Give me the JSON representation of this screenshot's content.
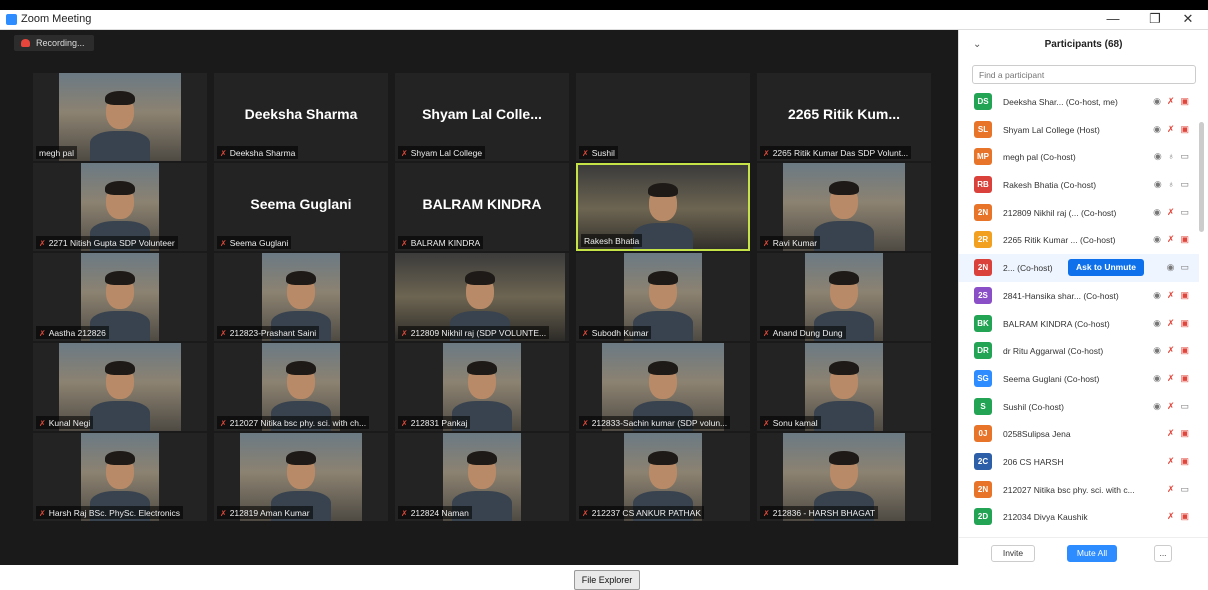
{
  "window": {
    "title": "Zoom Meeting",
    "minimize": "—",
    "restore": "❐",
    "close": "✕"
  },
  "recording": {
    "label": "Recording..."
  },
  "tiles": [
    {
      "name": "megh pal",
      "bigname": "",
      "video": "person",
      "mic_muted": false
    },
    {
      "name": "Deeksha Sharma",
      "bigname": "Deeksha Sharma",
      "video": "off",
      "mic_muted": true
    },
    {
      "name": "Shyam Lal College",
      "bigname": "Shyam Lal Colle...",
      "video": "off",
      "mic_muted": true
    },
    {
      "name": "Sushil",
      "bigname": "",
      "video": "off",
      "mic_muted": true
    },
    {
      "name": "2265 Ritik Kumar Das SDP Volunt...",
      "bigname": "2265 Ritik Kum...",
      "video": "off",
      "mic_muted": true
    },
    {
      "name": "2271 Nitish Gupta SDP Volunteer",
      "bigname": "",
      "video": "person",
      "mic_muted": true
    },
    {
      "name": "Seema Guglani",
      "bigname": "Seema Guglani",
      "video": "off",
      "mic_muted": true
    },
    {
      "name": "BALRAM KINDRA",
      "bigname": "BALRAM KINDRA",
      "video": "off",
      "mic_muted": true
    },
    {
      "name": "Rakesh Bhatia",
      "bigname": "",
      "video": "wide",
      "mic_muted": false,
      "active": true
    },
    {
      "name": "Ravi Kumar",
      "bigname": "",
      "video": "person",
      "mic_muted": true
    },
    {
      "name": "Aastha 212826",
      "bigname": "",
      "video": "person",
      "mic_muted": true
    },
    {
      "name": "212823-Prashant Saini",
      "bigname": "",
      "video": "person",
      "mic_muted": true
    },
    {
      "name": "212809 Nikhil raj (SDP VOLUNTE...",
      "bigname": "",
      "video": "wide",
      "mic_muted": true
    },
    {
      "name": "Subodh Kumar",
      "bigname": "",
      "video": "person",
      "mic_muted": true
    },
    {
      "name": "Anand Dung Dung",
      "bigname": "",
      "video": "person",
      "mic_muted": true
    },
    {
      "name": "Kunal Negi",
      "bigname": "",
      "video": "person",
      "mic_muted": true
    },
    {
      "name": "212027 Nitika bsc phy. sci. with ch...",
      "bigname": "",
      "video": "person",
      "mic_muted": true
    },
    {
      "name": "212831 Pankaj",
      "bigname": "",
      "video": "person",
      "mic_muted": true
    },
    {
      "name": "212833-Sachin kumar (SDP volun...",
      "bigname": "",
      "video": "person",
      "mic_muted": true
    },
    {
      "name": "Sonu kamal",
      "bigname": "",
      "video": "person",
      "mic_muted": true
    },
    {
      "name": "Harsh Raj BSc. PhySc. Electronics",
      "bigname": "",
      "video": "person",
      "mic_muted": true
    },
    {
      "name": "212819 Aman Kumar",
      "bigname": "",
      "video": "person",
      "mic_muted": true
    },
    {
      "name": "212824 Naman",
      "bigname": "",
      "video": "person",
      "mic_muted": true
    },
    {
      "name": "212237 CS ANKUR PATHAK",
      "bigname": "",
      "video": "person",
      "mic_muted": true
    },
    {
      "name": "212836 - HARSH BHAGAT",
      "bigname": "",
      "video": "person",
      "mic_muted": true
    }
  ],
  "file_explorer": {
    "label": "File Explorer"
  },
  "participants": {
    "title": "Participants (68)",
    "collapse": "⌄",
    "search_placeholder": "Find a participant",
    "list": [
      {
        "initials": "DS",
        "color": "#23a455",
        "name": "Deeksha Shar...  (Co-host, me)",
        "mic": "muted",
        "video": "off"
      },
      {
        "initials": "SL",
        "color": "#e8742a",
        "name": "Shyam Lal College (Host)",
        "mic": "muted",
        "video": "off"
      },
      {
        "initials": "MP",
        "color": "#e8742a",
        "name": "megh pal (Co-host)",
        "mic": "on",
        "video": "on"
      },
      {
        "initials": "RB",
        "color": "#d9413a",
        "name": "Rakesh Bhatia (Co-host)",
        "mic": "on",
        "video": "on"
      },
      {
        "initials": "2N",
        "color": "#e8742a",
        "name": "212809 Nikhil raj (...  (Co-host)",
        "mic": "muted",
        "video": "on"
      },
      {
        "initials": "2R",
        "color": "#f2a01f",
        "name": "2265 Ritik Kumar ...  (Co-host)",
        "mic": "muted",
        "video": "off"
      },
      {
        "initials": "2N",
        "color": "#d9413a",
        "name": "2...  (Co-host)",
        "mic": "",
        "video": "on",
        "unmute": "Ask to Unmute"
      },
      {
        "initials": "2S",
        "color": "#8a4fc7",
        "name": "2841-Hansika shar...  (Co-host)",
        "mic": "muted",
        "video": "off"
      },
      {
        "initials": "BK",
        "color": "#23a455",
        "name": "BALRAM KINDRA (Co-host)",
        "mic": "muted",
        "video": "off"
      },
      {
        "initials": "DR",
        "color": "#23a455",
        "name": "dr Ritu Aggarwal (Co-host)",
        "mic": "muted",
        "video": "off"
      },
      {
        "initials": "SG",
        "color": "#2d8cff",
        "name": "Seema Guglani (Co-host)",
        "mic": "muted",
        "video": "off"
      },
      {
        "initials": "S",
        "color": "#23a455",
        "name": "Sushil (Co-host)",
        "mic": "muted",
        "video": "on"
      },
      {
        "initials": "0J",
        "color": "#e8742a",
        "name": "0258Sulipsa Jena",
        "mic": "muted",
        "video": "off",
        "noeye": true
      },
      {
        "initials": "2C",
        "color": "#2d5ea8",
        "name": "206 CS HARSH",
        "mic": "muted",
        "video": "off",
        "noeye": true
      },
      {
        "initials": "2N",
        "color": "#e8742a",
        "name": "212027 Nitika bsc phy. sci. with c...",
        "mic": "muted",
        "video": "on",
        "noeye": true
      },
      {
        "initials": "2D",
        "color": "#23a455",
        "name": "212034 Divya Kaushik",
        "mic": "muted",
        "video": "off",
        "noeye": true
      }
    ],
    "footer": {
      "invite": "Invite",
      "mute_all": "Mute All",
      "more": "..."
    }
  }
}
